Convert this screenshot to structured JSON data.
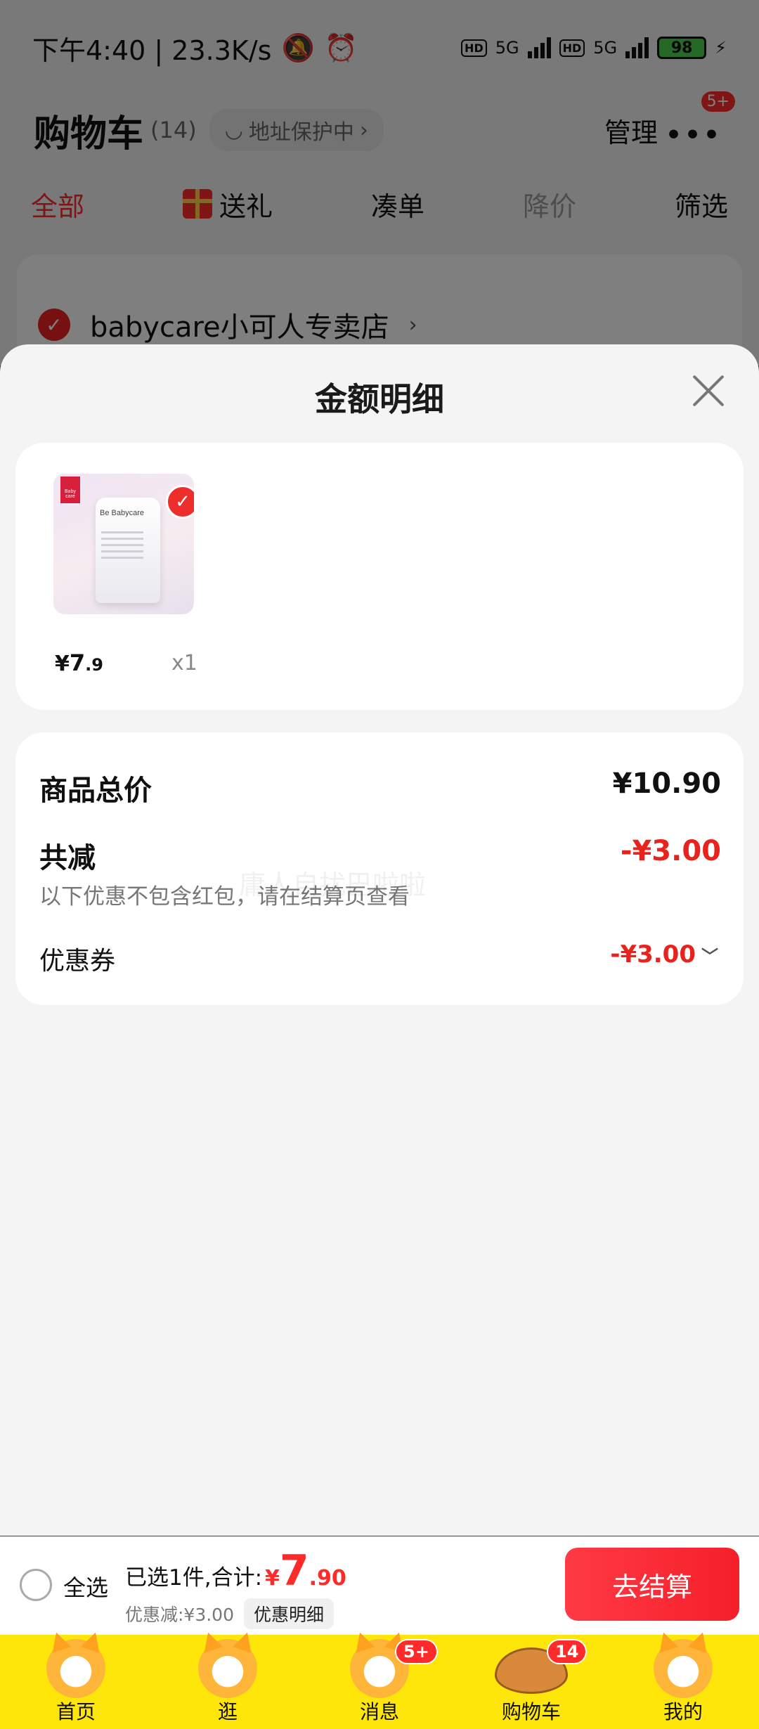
{
  "status_bar": {
    "time_speed": "下午4:40 | 23.3K/s",
    "network_1": "5G",
    "network_2": "5G",
    "hd_1": "HD",
    "hd_2": "HD",
    "battery": "98"
  },
  "header": {
    "title": "购物车",
    "count": "(14)",
    "address_protect": "地址保护中",
    "manage": "管理",
    "more_badge": "5+"
  },
  "tabs": [
    {
      "label": "全部"
    },
    {
      "label": "送礼"
    },
    {
      "label": "凑单"
    },
    {
      "label": "降价"
    },
    {
      "label": "筛选"
    }
  ],
  "store": {
    "name": "babycare小可人专卖店"
  },
  "sheet": {
    "title": "金额明细",
    "item": {
      "price_symbol": "¥",
      "price_int": "7",
      "price_dec": ".9",
      "quantity": "x1",
      "brand": "Be Babycare",
      "brand_tag": "Baby care"
    },
    "summary": {
      "total_label": "商品总价",
      "total_value": "¥10.90",
      "reduce_label": "共减",
      "reduce_value": "-¥3.00",
      "note": "以下优惠不包含红包，请在结算页查看",
      "coupon_label": "优惠券",
      "coupon_value": "-¥3.00"
    },
    "watermark": "庸人自扰巴啦啦"
  },
  "checkout": {
    "select_all": "全选",
    "selected_prefix": "已选1件,合计:",
    "total_symbol": "¥",
    "total_int": "7",
    "total_dec": ".90",
    "discount": "优惠减:¥3.00",
    "detail_button": "优惠明细",
    "checkout_button": "去结算"
  },
  "nav": [
    {
      "label": "首页",
      "icon": "home-mascot-icon"
    },
    {
      "label": "逛",
      "icon": "browse-mascot-icon"
    },
    {
      "label": "消息",
      "icon": "message-mascot-icon",
      "badge": "5+"
    },
    {
      "label": "购物车",
      "icon": "cart-fish-icon",
      "badge": "14"
    },
    {
      "label": "我的",
      "icon": "profile-mascot-icon"
    }
  ],
  "colors": {
    "accent_red": "#e8221d",
    "nav_yellow": "#ffe60a",
    "checkout_red": "#f51f2a"
  }
}
